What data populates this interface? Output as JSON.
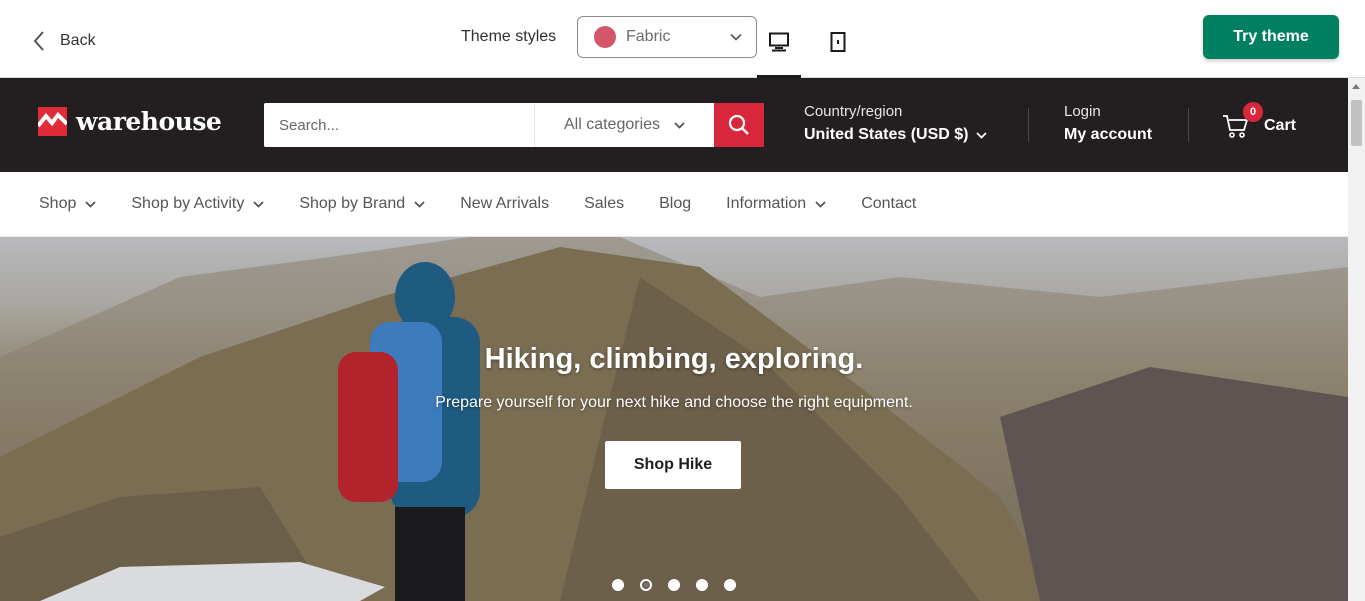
{
  "preview_bar": {
    "back_label": "Back",
    "theme_styles_label": "Theme styles",
    "theme_style_value": "Fabric",
    "swatch_color": "#d5566a",
    "try_theme_label": "Try theme",
    "try_theme_color": "#008060",
    "device_desktop_icon": "desktop-icon",
    "device_mobile_icon": "mobile-icon"
  },
  "store": {
    "logo_text": "warehouse",
    "search_placeholder": "Search...",
    "category_value": "All categories",
    "country_label": "Country/region",
    "country_value": "United States (USD $)",
    "login_label": "Login",
    "account_label": "My account",
    "cart_label": "Cart",
    "cart_count": "0",
    "accent_color": "#d8263c",
    "header_bg": "#231f20"
  },
  "nav": {
    "items": [
      {
        "label": "Shop",
        "dropdown": true
      },
      {
        "label": "Shop by Activity",
        "dropdown": true
      },
      {
        "label": "Shop by Brand",
        "dropdown": true
      },
      {
        "label": "New Arrivals",
        "dropdown": false
      },
      {
        "label": "Sales",
        "dropdown": false
      },
      {
        "label": "Blog",
        "dropdown": false
      },
      {
        "label": "Information",
        "dropdown": true
      },
      {
        "label": "Contact",
        "dropdown": false
      }
    ]
  },
  "hero": {
    "title": "Hiking, climbing, exploring.",
    "subtitle": "Prepare yourself for your next hike and choose the right equipment.",
    "button_label": "Shop Hike",
    "slide_count": 5,
    "active_slide": 2
  }
}
